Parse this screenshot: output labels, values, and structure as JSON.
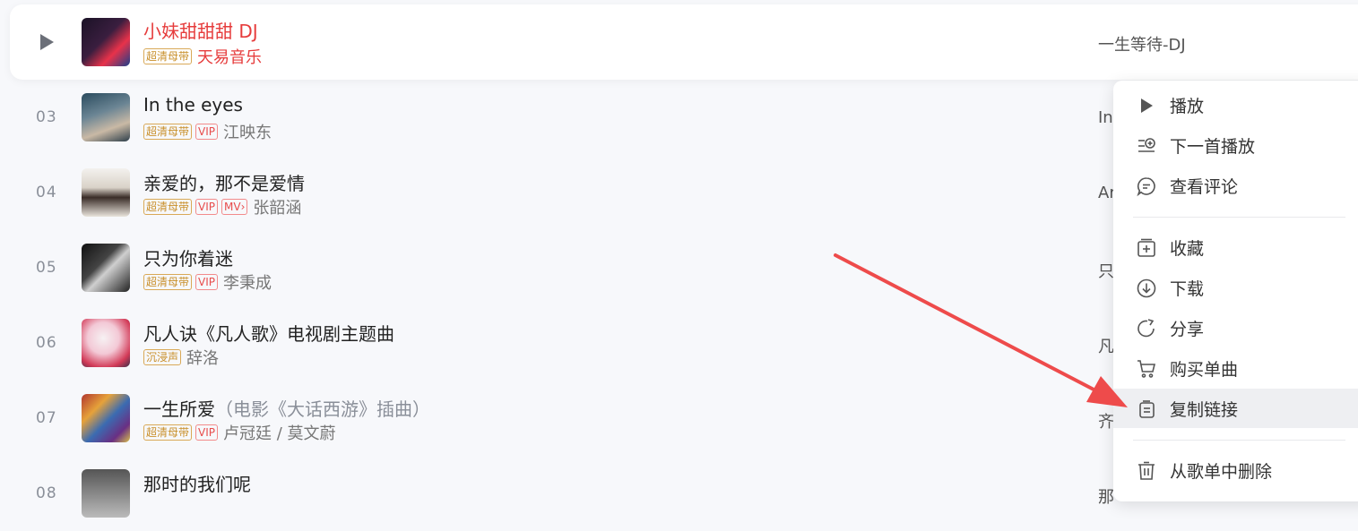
{
  "active_song": {
    "title": "小妹甜甜甜 DJ",
    "tag": "超清母带",
    "artist": "天易音乐",
    "album": "一生等待-DJ"
  },
  "songs": [
    {
      "num": "03",
      "title": "In the eyes",
      "sub": "",
      "tags": [
        "超清母带",
        "VIP"
      ],
      "artist": "江映东",
      "album": "In"
    },
    {
      "num": "04",
      "title": "亲爱的，那不是爱情",
      "sub": "",
      "tags": [
        "超清母带",
        "VIP",
        "MV"
      ],
      "artist": "张韶涵",
      "album": "Ar"
    },
    {
      "num": "05",
      "title": "只为你着迷",
      "sub": "",
      "tags": [
        "超清母带",
        "VIP"
      ],
      "artist": "李秉成",
      "album": "只"
    },
    {
      "num": "06",
      "title": "凡人诀《凡人歌》电视剧主题曲",
      "sub": "",
      "tags": [
        "沉浸声"
      ],
      "artist": "辞洛",
      "album": "凡"
    },
    {
      "num": "07",
      "title": "一生所爱",
      "sub": "（电影《大话西游》插曲）",
      "tags": [
        "超清母带",
        "VIP"
      ],
      "artist": "卢冠廷 / 莫文蔚",
      "album": "齐"
    },
    {
      "num": "08",
      "title": "那时的我们呢",
      "sub": "",
      "tags": [],
      "artist": "",
      "album": "那"
    }
  ],
  "context_menu": {
    "items": [
      {
        "label": "播放",
        "icon": "play-icon"
      },
      {
        "label": "下一首播放",
        "icon": "play-next-icon"
      },
      {
        "label": "查看评论",
        "icon": "comment-icon"
      },
      {
        "label": "收藏",
        "icon": "add-to-collection-icon"
      },
      {
        "label": "下载",
        "icon": "download-icon"
      },
      {
        "label": "分享",
        "icon": "share-icon"
      },
      {
        "label": "购买单曲",
        "icon": "cart-icon"
      },
      {
        "label": "复制链接",
        "icon": "copy-link-icon"
      },
      {
        "label": "从歌单中删除",
        "icon": "trash-icon"
      }
    ],
    "highlighted": "复制链接"
  },
  "colors": {
    "accent_red": "#e63c3c",
    "annotation_arrow": "#ee4b4b",
    "tag_gold": "#c9902b",
    "background": "#f7f8fb"
  }
}
